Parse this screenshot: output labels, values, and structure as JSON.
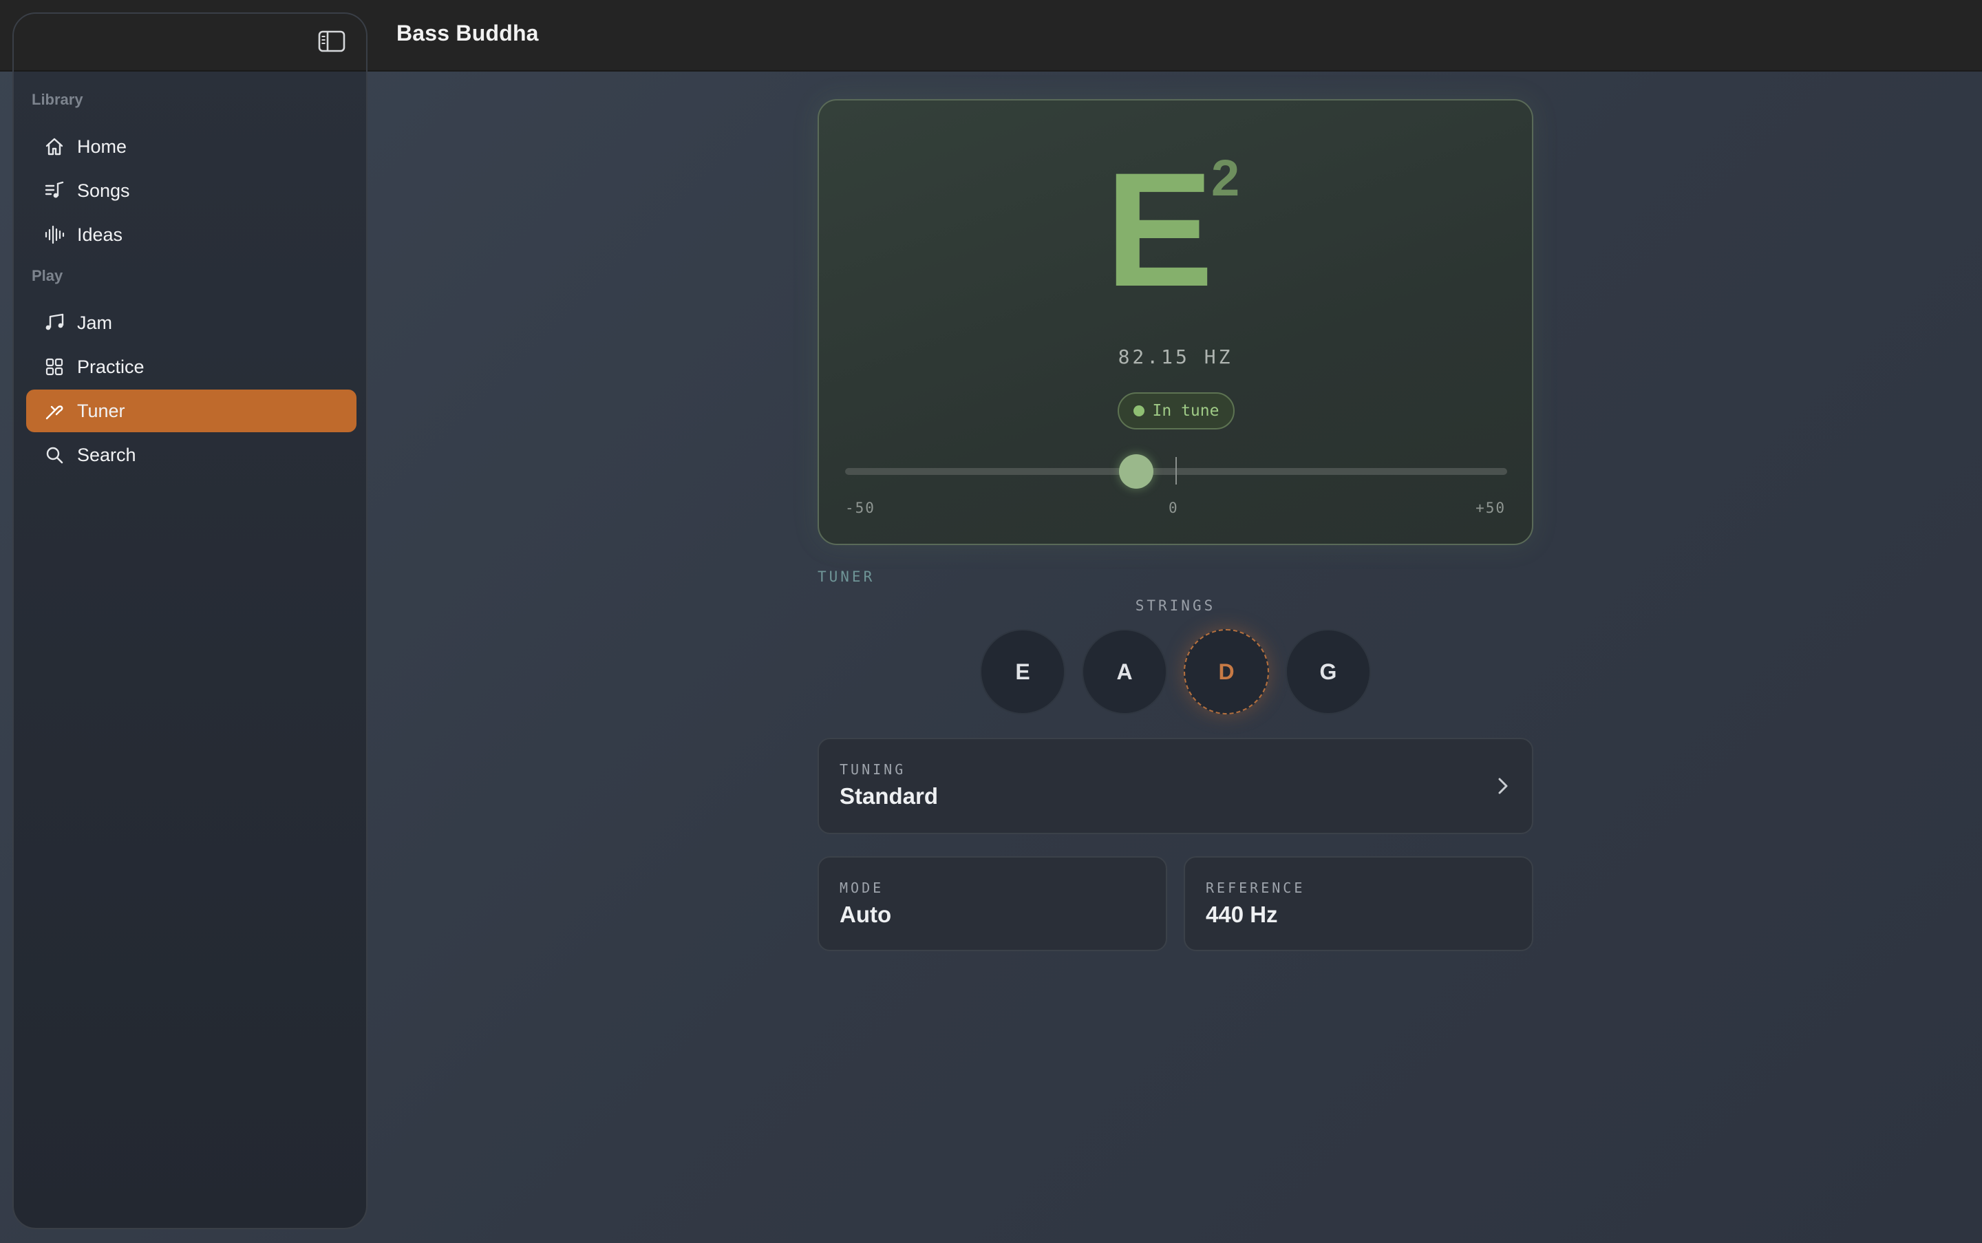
{
  "app": {
    "title": "Bass Buddha"
  },
  "sidebar": {
    "sections": [
      {
        "label": "Library"
      },
      {
        "label": "Play"
      }
    ],
    "items": [
      {
        "label": "Home",
        "icon": "home-icon"
      },
      {
        "label": "Songs",
        "icon": "music-list-icon"
      },
      {
        "label": "Ideas",
        "icon": "waveform-icon"
      },
      {
        "label": "Jam",
        "icon": "music-notes-icon"
      },
      {
        "label": "Practice",
        "icon": "grid-icon"
      },
      {
        "label": "Tuner",
        "icon": "tuning-fork-icon",
        "active": true
      },
      {
        "label": "Search",
        "icon": "search-icon"
      }
    ],
    "active_color": "#bf6a2c"
  },
  "tuner": {
    "note": "E",
    "octave": "2",
    "frequency": "82.15 HZ",
    "status": "In tune",
    "status_color": "#8fbf73",
    "meter": {
      "min_label": "-50",
      "center_label": "0",
      "max_label": "+50",
      "value_cents": -6
    }
  },
  "tuner_heading": "TUNER",
  "strings": {
    "heading": "STRINGS",
    "items": [
      "E",
      "A",
      "D",
      "G"
    ],
    "selected": "D"
  },
  "tuning": {
    "label": "TUNING",
    "value": "Standard"
  },
  "mode": {
    "label": "MODE",
    "value": "Auto"
  },
  "reference": {
    "label": "REFERENCE",
    "value": "440 Hz"
  }
}
